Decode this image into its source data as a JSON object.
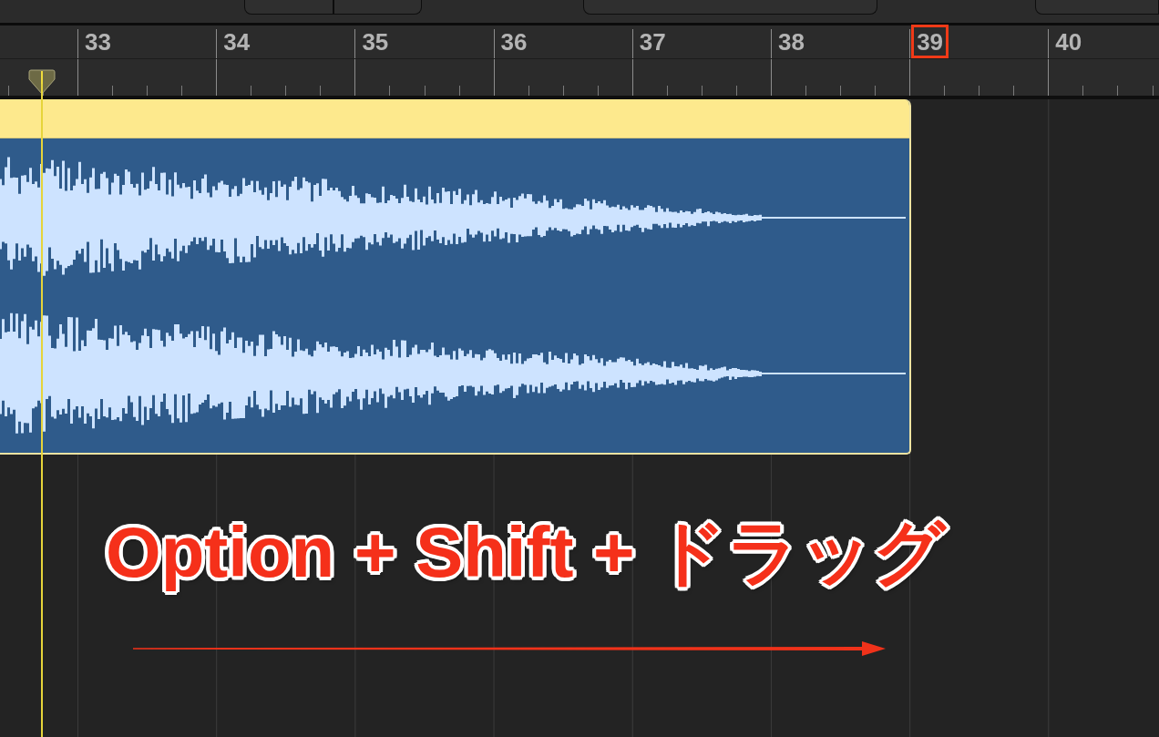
{
  "ruler": {
    "bars": [
      {
        "label": "33",
        "highlighted": false
      },
      {
        "label": "34",
        "highlighted": false
      },
      {
        "label": "35",
        "highlighted": false
      },
      {
        "label": "36",
        "highlighted": false
      },
      {
        "label": "37",
        "highlighted": false
      },
      {
        "label": "38",
        "highlighted": false
      },
      {
        "label": "39",
        "highlighted": true
      },
      {
        "label": "40",
        "highlighted": false
      }
    ]
  },
  "annotation": {
    "text": "Option + Shift + ドラッグ"
  }
}
